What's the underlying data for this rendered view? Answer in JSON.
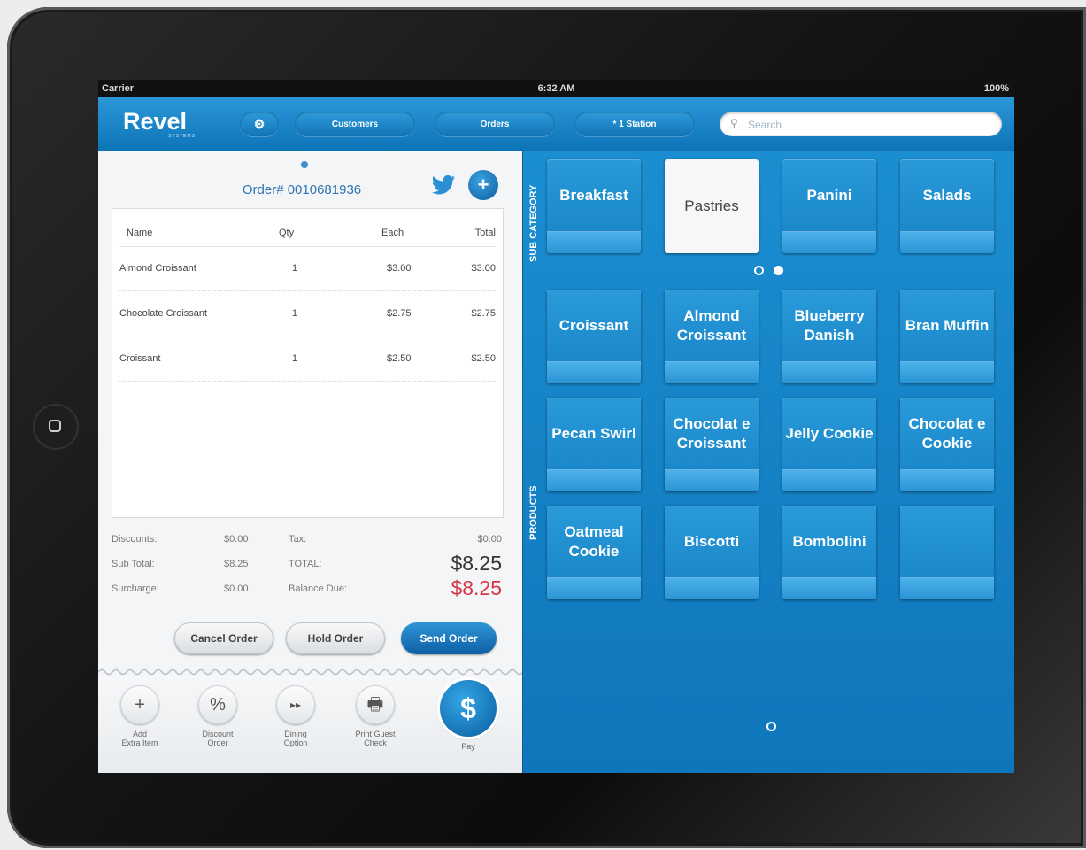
{
  "status": {
    "carrier": "Carrier",
    "time": "6:32 AM",
    "battery": "100%"
  },
  "header": {
    "logo": "Revel",
    "logo_sub": "SYSTEMS",
    "customers_label": "Customers",
    "orders_label": "Orders",
    "station_label": "* 1 Station",
    "search_placeholder": "Search"
  },
  "order": {
    "number": "Order# 0010681936",
    "columns": {
      "name": "Name",
      "qty": "Qty",
      "each": "Each",
      "total": "Total"
    },
    "items": [
      {
        "name": "Almond Croissant",
        "qty": "1",
        "each": "$3.00",
        "total": "$3.00"
      },
      {
        "name": "Chocolate Croissant",
        "qty": "1",
        "each": "$2.75",
        "total": "$2.75"
      },
      {
        "name": "Croissant",
        "qty": "1",
        "each": "$2.50",
        "total": "$2.50"
      }
    ],
    "totals": {
      "discounts_label": "Discounts:",
      "discounts": "$0.00",
      "subtotal_label": "Sub Total:",
      "subtotal": "$8.25",
      "surcharge_label": "Surcharge:",
      "surcharge": "$0.00",
      "tax_label": "Tax:",
      "tax": "$0.00",
      "total_label": "TOTAL:",
      "total": "$8.25",
      "balance_label": "Balance Due:",
      "balance": "$8.25"
    },
    "buttons": {
      "cancel": "Cancel Order",
      "hold": "Hold Order",
      "send": "Send Order"
    }
  },
  "actions": [
    {
      "icon": "+",
      "line1": "Add",
      "line2": "Extra Item"
    },
    {
      "icon": "%",
      "line1": "Discount",
      "line2": "Order"
    },
    {
      "icon": "▸▸",
      "line1": "Dining",
      "line2": "Option"
    },
    {
      "icon": "🖶",
      "line1": "Print Guest",
      "line2": "Check"
    },
    {
      "icon": "$",
      "line1": "Pay",
      "line2": ""
    }
  ],
  "panel": {
    "subcategory_label": "SUB CATEGORY",
    "products_label": "PRODUCTS",
    "subcategories": [
      "Breakfast",
      "Pastries",
      "Panini",
      "Salads"
    ],
    "selected_subcategory": "Pastries",
    "products": [
      "Croissant",
      "Almond Croissant",
      "Blueberry Danish",
      "Bran Muffin",
      "Pecan Swirl",
      "Chocolat e Croissant",
      "Jelly Cookie",
      "Chocolat e Cookie",
      "Oatmeal Cookie",
      "Biscotti",
      "Bombolini",
      ""
    ]
  },
  "colors": {
    "accent": "#1582c5",
    "balance_red": "#d5364a"
  }
}
